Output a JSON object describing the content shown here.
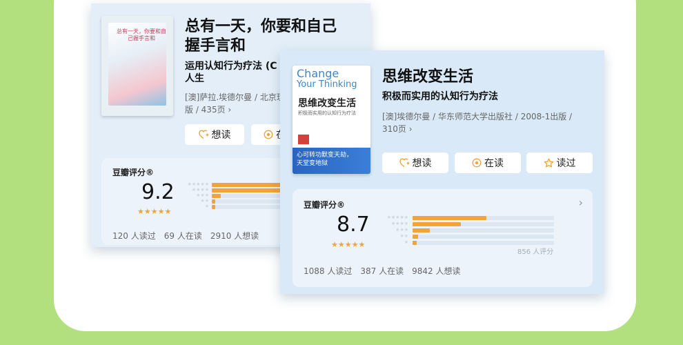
{
  "colors": {
    "background_green": "#b3e07e",
    "accent_orange": "#f0a43a",
    "card_blue": "#e3eef8"
  },
  "book1": {
    "title_line1": "总有一天，你要和自己",
    "title_line2": "握手言和",
    "subtitle_line1": "运用认知行为疗法 (C",
    "subtitle_line2": "人生",
    "meta_line1": "[澳]萨拉.埃德尔曼 / 北京理",
    "meta_line2": "版 / 435页 ›",
    "cover_text": "总有一天，你要和自己握手言和",
    "btn_want": "想读",
    "btn_reading": "在",
    "rating_label": "豆瓣评分®",
    "score": "9.2",
    "stars_filled": 4.5,
    "distribution": [
      0.7,
      0.45,
      0.06,
      0.02,
      0.02
    ],
    "stats": {
      "read": "120 人读过",
      "reading": "69 人在读",
      "want": "2910 人想读"
    }
  },
  "book2": {
    "title": "思维改变生活",
    "subtitle": "积极而实用的认知行为疗法",
    "meta_line1": "[澳]埃德尔曼 / 华东师范大学出版社 / 2008-1出版 /",
    "meta_line2": "310页 ›",
    "cover_en_line1": "Change",
    "cover_en_line2": "Your Thinking",
    "cover_cn_title": "思维改变生活",
    "cover_cn_sub": "积极而实用的认知行为疗法",
    "cover_slogan_line1": "心可转功默变天劫，",
    "cover_slogan_line2": "天堂变地狱",
    "btn_want": "想读",
    "btn_reading": "在读",
    "btn_read": "读过",
    "rating_label": "豆瓣评分®",
    "rating_chevron": "›",
    "score": "8.7",
    "stars_filled": 4.5,
    "distribution": [
      0.52,
      0.34,
      0.12,
      0.04,
      0.03
    ],
    "rating_count": "856 人评分",
    "stats": {
      "read": "1088 人读过",
      "reading": "387 人在读",
      "want": "9842 人想读"
    }
  }
}
